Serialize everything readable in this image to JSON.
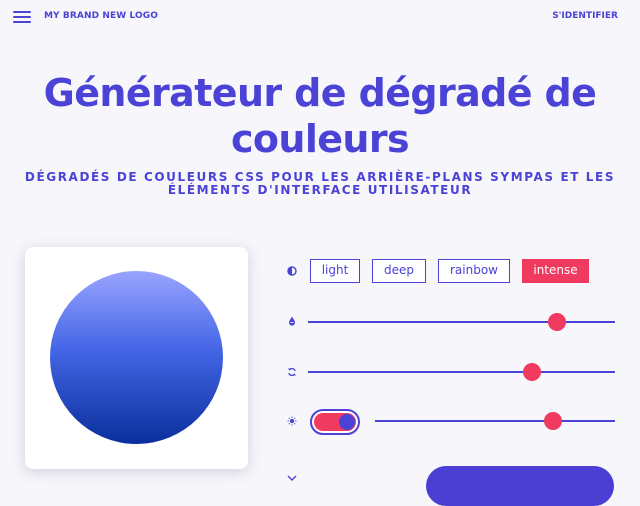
{
  "header": {
    "brand": "MY BRAND NEW LOGO",
    "signin": "S'IDENTIFIER"
  },
  "hero": {
    "title": "Générateur de dégradé de couleurs",
    "subtitle": "DÉGRADÉS DE COULEURS CSS POUR LES ARRIÈRE-PLANS SYMPAS ET LES ÉLÉMENTS D'INTERFACE UTILISATEUR"
  },
  "preview": {
    "gradient_colors": [
      "#9aa4ff",
      "#4466e6",
      "#0a2f9c"
    ]
  },
  "controls": {
    "modes": [
      "light",
      "deep",
      "rainbow",
      "intense"
    ],
    "selected_mode": "intense",
    "sliders": [
      {
        "name": "saturation",
        "icon": "droplet-icon",
        "value": 0.81
      },
      {
        "name": "rotation",
        "icon": "rotate-icon",
        "value": 0.73
      },
      {
        "name": "brightness",
        "icon": "sun-icon",
        "value": 0.74
      }
    ],
    "toggle_on": true
  },
  "colors": {
    "primary": "#4b43d6",
    "accent": "#f03a5f",
    "background": "#f6f6fb"
  }
}
